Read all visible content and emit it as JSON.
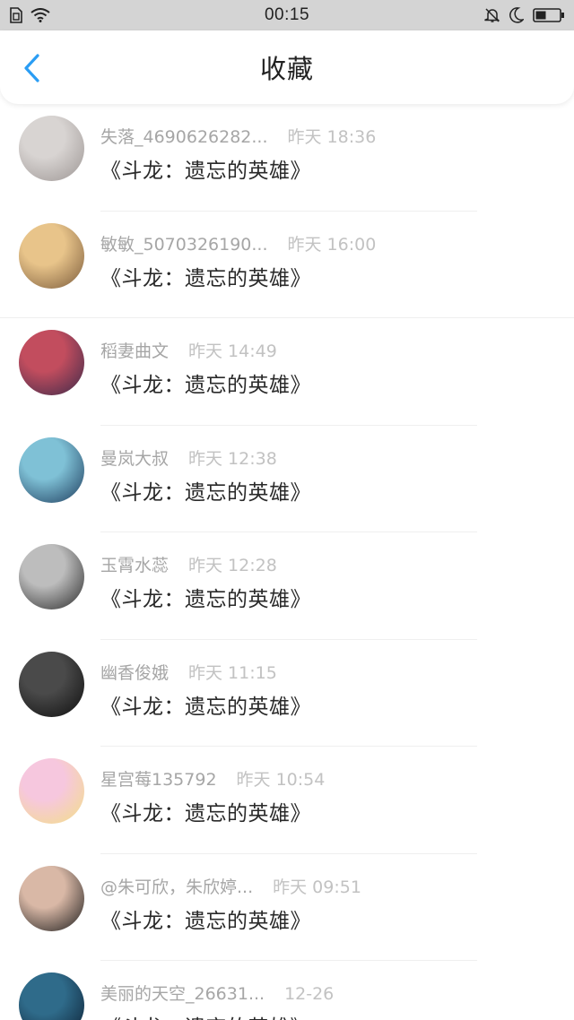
{
  "status_bar": {
    "time": "00:15",
    "icons": [
      "sim-icon",
      "wifi-icon",
      "mute-icon",
      "moon-icon",
      "battery-icon"
    ]
  },
  "header": {
    "title": "收藏",
    "back_icon": "chevron-left-icon",
    "accent": "#2a9df4"
  },
  "list": [
    {
      "name": "失落_4690626282...",
      "time": "昨天 18:36",
      "title": "《斗龙：遗忘的英雄》",
      "avatar_colors": [
        "#d8d4d2",
        "#9c9593"
      ]
    },
    {
      "name": "敏敏_5070326190...",
      "time": "昨天 16:00",
      "title": "《斗龙：遗忘的英雄》",
      "avatar_colors": [
        "#e8c48a",
        "#7a5a3a"
      ]
    },
    {
      "name": "稻妻曲文",
      "time": "昨天 14:49",
      "title": "《斗龙：遗忘的英雄》",
      "avatar_colors": [
        "#c24d5e",
        "#3b2a4a"
      ]
    },
    {
      "name": "曼岚大叔",
      "time": "昨天 12:38",
      "title": "《斗龙：遗忘的英雄》",
      "avatar_colors": [
        "#7fc1d6",
        "#1d3b5c"
      ]
    },
    {
      "name": "玉霄水蕊",
      "time": "昨天 12:28",
      "title": "《斗龙：遗忘的英雄》",
      "avatar_colors": [
        "#bdbdbd",
        "#2a2a2a"
      ]
    },
    {
      "name": "幽香俊娥",
      "time": "昨天 11:15",
      "title": "《斗龙：遗忘的英雄》",
      "avatar_colors": [
        "#4a4a4a",
        "#0e0e0e"
      ]
    },
    {
      "name": "星宫莓135792",
      "time": "昨天 10:54",
      "title": "《斗龙：遗忘的英雄》",
      "avatar_colors": [
        "#f6c7de",
        "#f3df85"
      ]
    },
    {
      "name": "@朱可欣，朱欣婷...",
      "time": "昨天 09:51",
      "title": "《斗龙：遗忘的英雄》",
      "avatar_colors": [
        "#d9b8a6",
        "#1b1b1b"
      ]
    },
    {
      "name": "美丽的天空_26631...",
      "time": "12-26",
      "title": "《斗龙：遗忘的英雄》",
      "avatar_colors": [
        "#2f6b8a",
        "#0c1f33"
      ]
    }
  ]
}
